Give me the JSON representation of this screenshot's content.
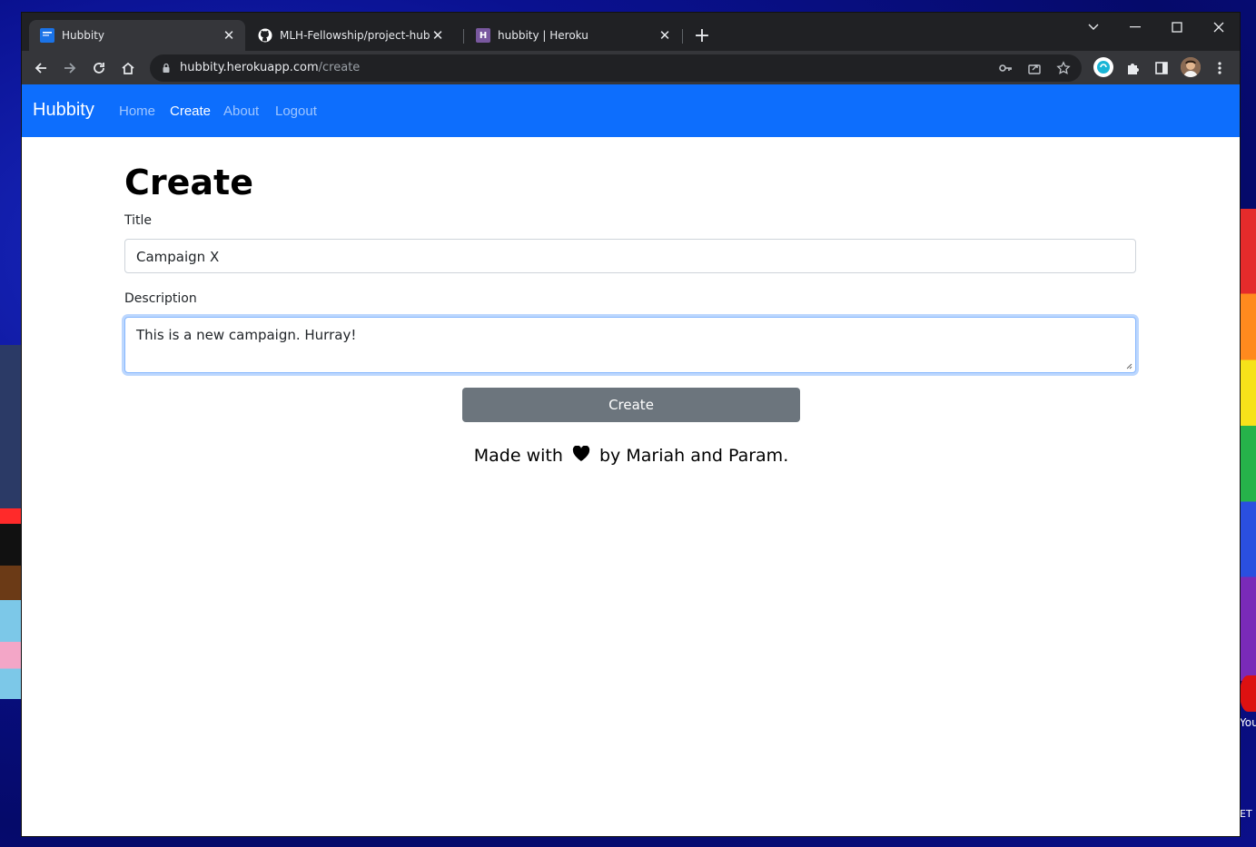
{
  "browser": {
    "tabs": [
      {
        "title": "Hubbity",
        "favicon_color": "#1a73e8"
      },
      {
        "title": "MLH-Fellowship/project-hubbity",
        "favicon_color": "#ffffff"
      },
      {
        "title": "hubbity | Heroku",
        "favicon_color": "#79589f",
        "favicon_letter": "H"
      }
    ],
    "address": {
      "host": "hubbity.herokuapp.com",
      "path": "/create"
    }
  },
  "navbar": {
    "brand": "Hubbity",
    "links": [
      {
        "label": "Home",
        "active": false
      },
      {
        "label": "Create",
        "active": true
      },
      {
        "label": "About",
        "active": false
      },
      {
        "label": "Logout",
        "active": false
      }
    ],
    "color": "#0d6efd"
  },
  "form": {
    "heading": "Create",
    "title_label": "Title",
    "title_value": "Campaign X",
    "description_label": "Description",
    "description_value": "This is a new campaign. Hurray!",
    "submit_label": "Create",
    "submit_color": "#6c757d"
  },
  "footer": {
    "prefix": "Made with",
    "suffix": "by Mariah and Param."
  },
  "desktop": {
    "text1": "You Mu",
    "text2": "ET In the"
  }
}
